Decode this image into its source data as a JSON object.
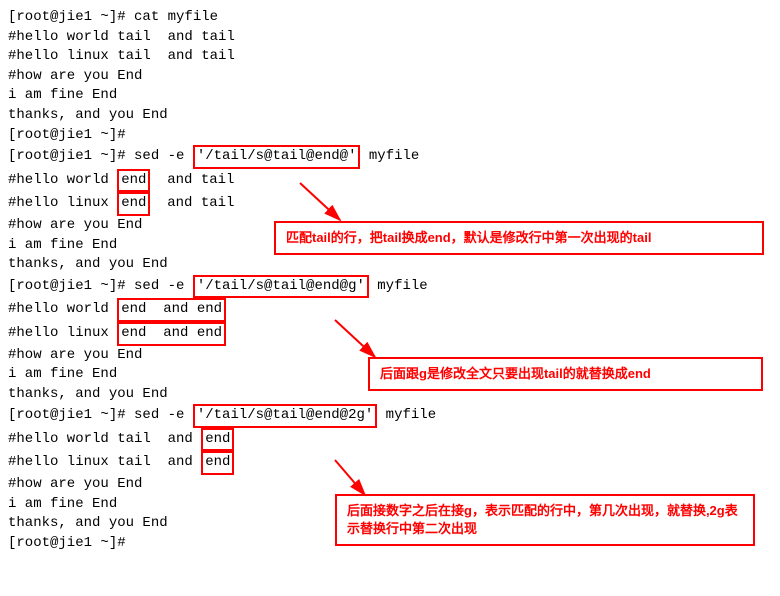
{
  "prompt": "[root@jie1 ~]#",
  "cmd_cat": " cat myfile",
  "file_lines": {
    "l1_prefix": "#hello world ",
    "l1_word": "tail",
    "l1_suffix": "  and tail",
    "l2_prefix": "#hello linux ",
    "l2_word": "tail",
    "l2_suffix": "  and tail",
    "l3": "#how are you End",
    "l4": "i am fine End",
    "l5": "thanks, and you End"
  },
  "sed1": {
    "cmd_prefix": " sed -e ",
    "cmd_arg": "'/tail/s@tail@end@'",
    "cmd_suffix": " myfile",
    "out1_prefix": "#hello world ",
    "out1_word": "end",
    "out1_suffix": "  and tail",
    "out2_prefix": "#hello linux ",
    "out2_word": "end",
    "out2_suffix": "  and tail"
  },
  "sed2": {
    "cmd_prefix": " sed -e ",
    "cmd_arg": "'/tail/s@tail@end@g'",
    "cmd_suffix": " myfile",
    "out1_prefix": "#hello world ",
    "out1_rest": "end  and end",
    "out2_prefix": "#hello linux ",
    "out2_rest": "end  and end"
  },
  "sed3": {
    "cmd_prefix": " sed -e ",
    "cmd_arg": "'/tail/s@tail@end@2g'",
    "cmd_suffix": " myfile",
    "out1_prefix": "#hello world tail  and ",
    "out1_word": "end",
    "out2_prefix": "#hello linux tail  and ",
    "out2_word": "end"
  },
  "annotations": {
    "a1": "匹配tail的行，把tail换成end，默认是修改行中第一次出现的tail",
    "a2": "后面跟g是修改全文只要出现tail的就替换成end",
    "a3": "后面接数字之后在接g，表示匹配的行中，第几次出现，就替换,2g表示替换行中第二次出现"
  }
}
